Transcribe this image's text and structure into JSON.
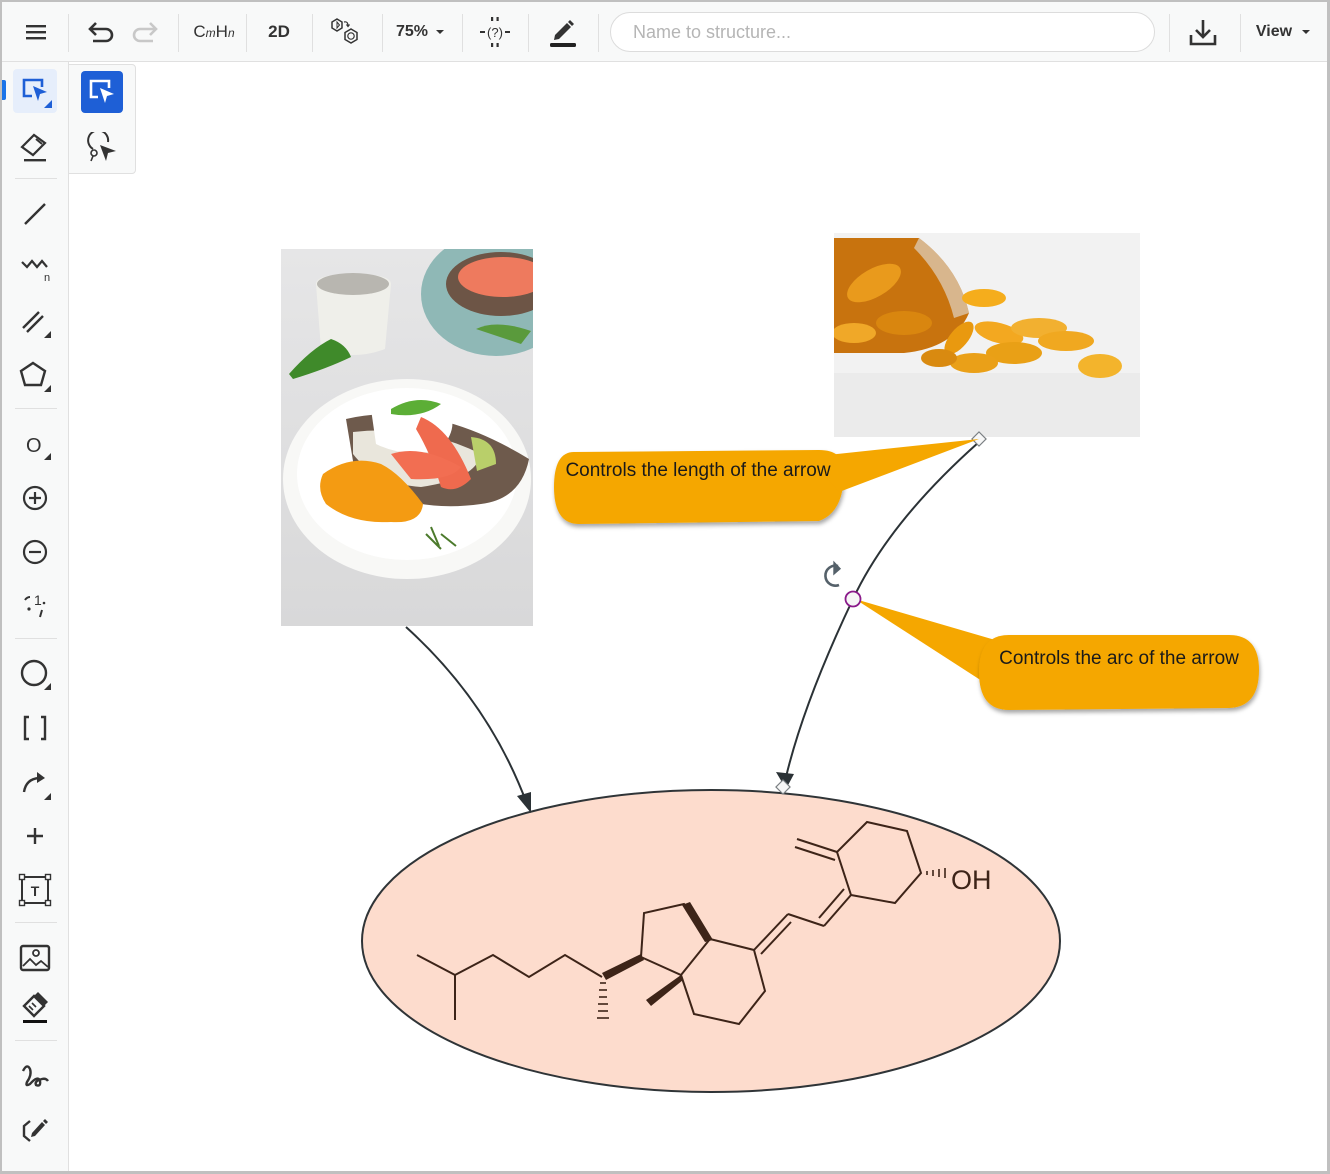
{
  "toolbar": {
    "menu_icon": "hamburger-menu-icon",
    "undo_icon": "undo-icon",
    "redo_icon": "redo-icon",
    "formula_label_c": "C",
    "formula_label_m": "m",
    "formula_label_h": "H",
    "formula_label_n": "n",
    "dimension_label": "2D",
    "clean_structure_icon": "clean-structure-icon",
    "zoom_level": "75%",
    "unknown_group_icon": "unknown-fragment-icon",
    "pen_color_icon": "pen-color-icon",
    "search_placeholder": "Name to structure...",
    "search_value": "",
    "download_icon": "download-icon",
    "view_label": "View"
  },
  "sidebar": {
    "items": [
      {
        "name": "select-tool",
        "icon": "selection-icon",
        "active": true
      },
      {
        "name": "eraser-tool",
        "icon": "eraser-icon"
      },
      {
        "name": "single-bond-tool",
        "icon": "single-bond-icon"
      },
      {
        "name": "chain-tool",
        "icon": "chain-icon",
        "sub": "n"
      },
      {
        "name": "bond-types-tool",
        "icon": "double-bond-icon"
      },
      {
        "name": "ring-tool",
        "icon": "pentagon-ring-icon"
      },
      {
        "name": "atom-tool",
        "icon": "atom-icon",
        "label": "O"
      },
      {
        "name": "positive-charge-tool",
        "icon": "plus-circle-icon"
      },
      {
        "name": "negative-charge-tool",
        "icon": "minus-circle-icon"
      },
      {
        "name": "radical-tool",
        "icon": "radical-icon",
        "label": "1"
      },
      {
        "name": "shapes-tool",
        "icon": "circle-shape-icon"
      },
      {
        "name": "brackets-tool",
        "icon": "brackets-icon",
        "label": "[ ]"
      },
      {
        "name": "arrow-tool",
        "icon": "curved-arrow-icon"
      },
      {
        "name": "plus-tool",
        "icon": "plus-icon"
      },
      {
        "name": "text-tool",
        "icon": "text-box-icon",
        "label": "T"
      },
      {
        "name": "image-tool",
        "icon": "image-icon"
      },
      {
        "name": "fill-tool",
        "icon": "paint-bucket-icon"
      },
      {
        "name": "freehand-tool",
        "icon": "freehand-icon"
      },
      {
        "name": "draw-structure-tool",
        "icon": "draw-ring-pencil-icon"
      }
    ]
  },
  "flyout": {
    "items": [
      {
        "name": "rectangle-select",
        "icon": "rectangle-select-icon",
        "active": true
      },
      {
        "name": "lasso-select",
        "icon": "lasso-select-icon"
      }
    ]
  },
  "canvas": {
    "images": [
      {
        "name": "food-photo",
        "description": "poached egg and smoked salmon toast"
      },
      {
        "name": "capsules-photo",
        "description": "vitamin D capsules spilling from bottle"
      }
    ],
    "callouts": [
      {
        "name": "length-callout",
        "text": "Controls the length of the arrow",
        "color": "#f5a700"
      },
      {
        "name": "arc-callout",
        "text": "Controls the arc of the arrow",
        "color": "#f5a700"
      }
    ],
    "molecule": {
      "name": "vitamin-d3-structure",
      "label_oh": "OH",
      "fill": "#fddccd",
      "bond_color": "#3d2418"
    },
    "handles": {
      "arc_handle_color": "#8a1a8a",
      "rotate_icon": "rotate-icon"
    }
  },
  "colors": {
    "accent": "#1a73e8",
    "active_tool": "#1e5fd6",
    "callout": "#f5a700",
    "ellipse_fill": "#fddccd"
  }
}
